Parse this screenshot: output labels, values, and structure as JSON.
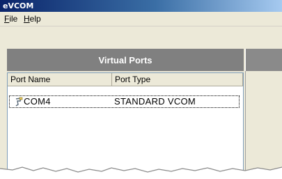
{
  "window": {
    "title": "eVCOM"
  },
  "menu": {
    "file": "File",
    "help": "Help",
    "file_ul": "F",
    "file_rest": "ile",
    "help_ul": "H",
    "help_rest": "elp"
  },
  "panel": {
    "header": "Virtual Ports"
  },
  "table": {
    "columns": [
      "Port Name",
      "Port Type"
    ],
    "rows": [
      {
        "port_name": "COM4",
        "port_type": "STANDARD VCOM"
      }
    ]
  },
  "icons": {
    "row_icon": "serial-port-icon"
  }
}
